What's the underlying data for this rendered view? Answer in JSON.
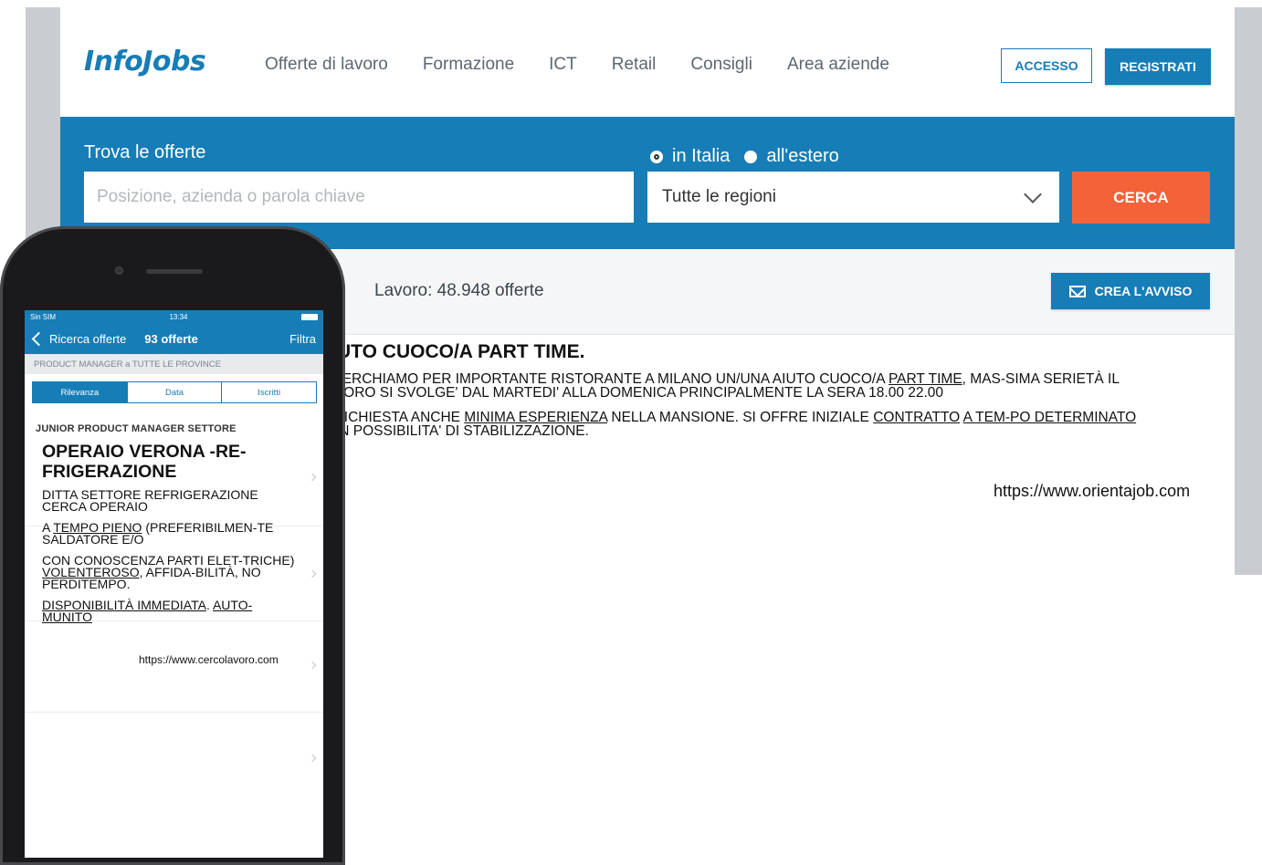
{
  "site": {
    "logo": "InfoJobs",
    "nav": [
      "Offerte di lavoro",
      "Formazione",
      "ICT",
      "Retail",
      "Consigli",
      "Area aziende"
    ],
    "login_label": "ACCESSO",
    "register_label": "REGISTRATI",
    "colors": {
      "brand": "#167db7",
      "cta": "#f4623a"
    }
  },
  "search": {
    "label": "Trova le offerte",
    "radio_italy": "in Italia",
    "radio_abroad": "all'estero",
    "selected_radio": "in Italia",
    "placeholder": "Posizione, azienda o parola chiave",
    "region": "Tutte le regioni",
    "button": "CERCA"
  },
  "results": {
    "count_text": "Lavoro: 48.948 offerte",
    "alert_button": "CREA L'AVVISO",
    "alert_icon": "envelope-icon"
  },
  "job": {
    "title": "AIUTO CUOCO/A PART TIME.",
    "p1_a": "RICERCHIAMO PER IMPORTANTE RISTORANTE A MILANO UN/UNA AIUTO CUOCO/A ",
    "p1_link": "PART TIME",
    "p1_b": ", MAS-SIMA SERIETÀ  IL LAVORO SI SVOLGE' DAL MARTEDI' ALLA DOMENICA PRINCIPALMENTE LA SERA 18.00 22.00",
    "p2_a": "E' RICHIESTA ANCHE ",
    "p2_link1": "MINIMA ESPERIENZA",
    "p2_b": " NELLA MANSIONE. SI OFFRE INIZIALE ",
    "p2_link2": "CONTRATTO",
    "p2_c": " ",
    "p2_link3": "A TEM-PO DETERMINATO",
    "p2_d": " CON POSSIBILITA' DI STABILIZZAZIONE.",
    "source": "https://www.orientajob.com"
  },
  "phone": {
    "carrier": "Sin SIM",
    "time": "13:34",
    "back_label": "Ricerca offerte",
    "count": "93 offerte",
    "filter": "Filtra",
    "breadcrumb": "PRODUCT MANAGER a TUTTE LE PROVINCE",
    "tabs": [
      "Rilevanza",
      "Data",
      "Iscritti"
    ],
    "peek_title": "JUNIOR PRODUCT MANAGER SETTORE",
    "job": {
      "title": "OPERAIO VERONA -RE-FRIGERAZIONE",
      "p1": "DITTA SETTORE REFRIGERAZIONE CERCA OPERAIO",
      "p2_a": "A ",
      "p2_link": "TEMPO PIENO",
      "p2_b": " (PREFERIBILMEN-TE SALDATORE E/O",
      "p3_a": "CON CONOSCENZA PARTI ELET-TRICHE) ",
      "p3_link": "VOLENTEROSO",
      "p3_b": ", AFFIDA-BILITÀ, NO PERDITEMPO.",
      "p4_link1": "DISPONIBILITÀ IMMEDIATA",
      "p4_a": ". ",
      "p4_link2": "AUTO-MUNITO",
      "source": "https://www.cercolavoro.com"
    }
  }
}
